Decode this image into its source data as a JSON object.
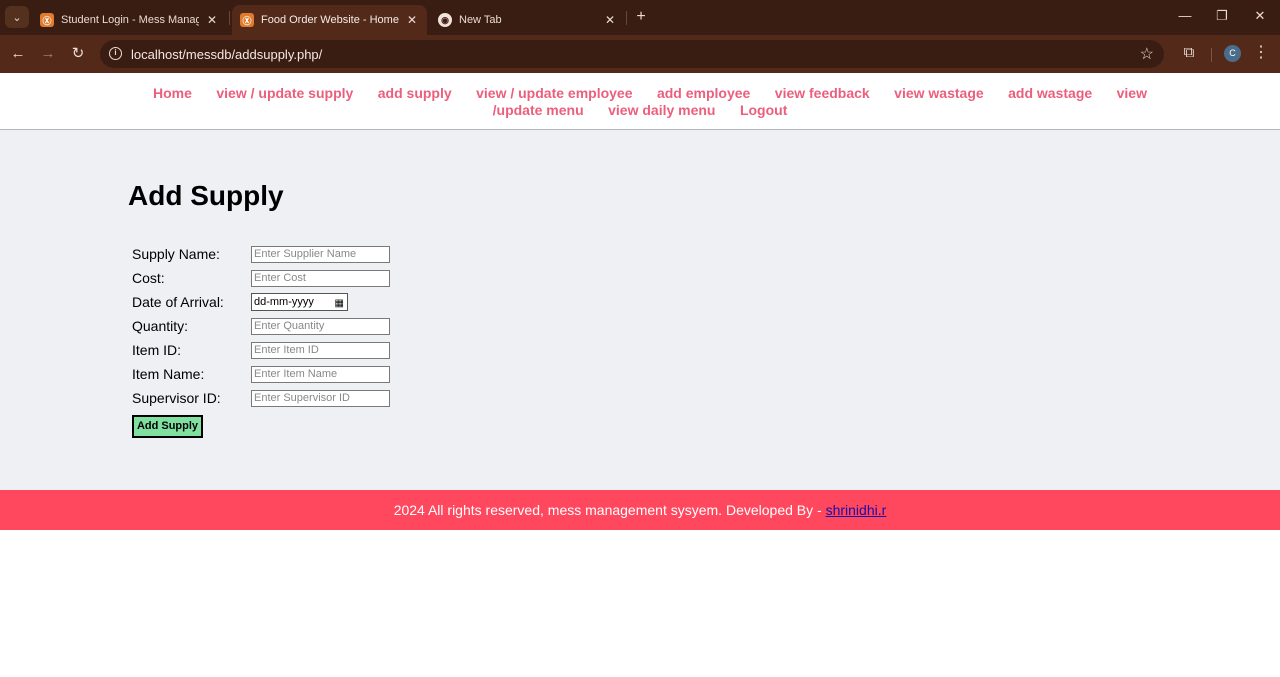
{
  "browser": {
    "tabs": [
      {
        "title": "Student Login - Mess Managem",
        "icon": "xampp-icon",
        "active": false
      },
      {
        "title": "Food Order Website - Home Pa",
        "icon": "xampp-icon",
        "active": true
      },
      {
        "title": "New Tab",
        "icon": "chrome-icon",
        "active": false
      }
    ],
    "url": "localhost/messdb/addsupply.php/",
    "profile_initial": "C"
  },
  "nav": {
    "links": [
      "Home",
      "view / update supply",
      "add supply",
      "view / update employee",
      "add employee",
      "view feedback",
      "view wastage",
      "add wastage",
      "view /update menu",
      "view daily menu",
      "Logout"
    ],
    "link_color": "#ec5f7c"
  },
  "main": {
    "title": "Add Supply",
    "fields": [
      {
        "label": "Supply Name:",
        "placeholder": "Enter Supplier Name"
      },
      {
        "label": "Cost:",
        "placeholder": "Enter Cost"
      },
      {
        "label": "Date of Arrival:",
        "value": "dd-mm-yyyy"
      },
      {
        "label": "Quantity:",
        "placeholder": "Enter Quantity"
      },
      {
        "label": "Item ID:",
        "placeholder": "Enter Item ID"
      },
      {
        "label": "Item Name:",
        "placeholder": "Enter Item Name"
      },
      {
        "label": "Supervisor ID:",
        "placeholder": "Enter Supervisor ID"
      }
    ],
    "submit_label": "Add Supply",
    "submit_color": "#7fe0a0"
  },
  "footer": {
    "text": "2024 All rights reserved, mess management sysyem. Developed By - ",
    "link": "shrinidhi.r",
    "background": "#ff475d"
  }
}
